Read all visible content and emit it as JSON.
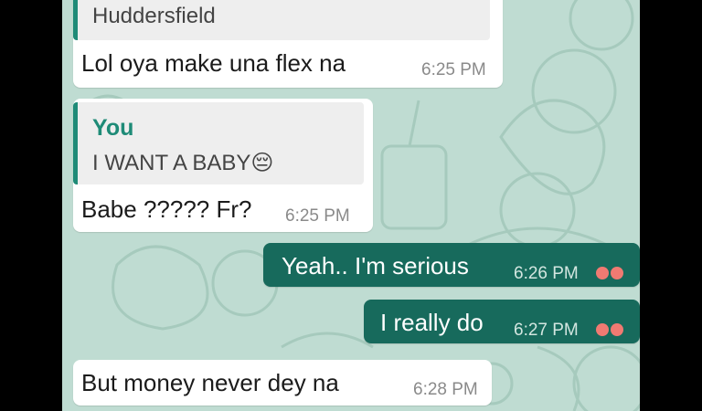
{
  "messages": [
    {
      "quote_text": "Huddersfield",
      "text": "Lol oya make una flex na",
      "time": "6:25 PM"
    },
    {
      "quote_author": "You",
      "quote_text": "I WANT A BABY😔",
      "text": "Babe ????? Fr?",
      "time": "6:25 PM"
    },
    {
      "text": "Yeah.. I'm serious",
      "time": "6:26 PM",
      "ticks_icon": "read-receipt-icon"
    },
    {
      "text": "I really do",
      "time": "6:27 PM",
      "ticks_icon": "read-receipt-icon"
    },
    {
      "text": "But money never dey na",
      "time": "6:28 PM"
    }
  ],
  "colors": {
    "chat_bg": "#bfdcd2",
    "incoming_bubble": "#ffffff",
    "outgoing_bubble": "#176a5c",
    "quote_accent": "#1e8b77",
    "tick": "#f07a72"
  }
}
